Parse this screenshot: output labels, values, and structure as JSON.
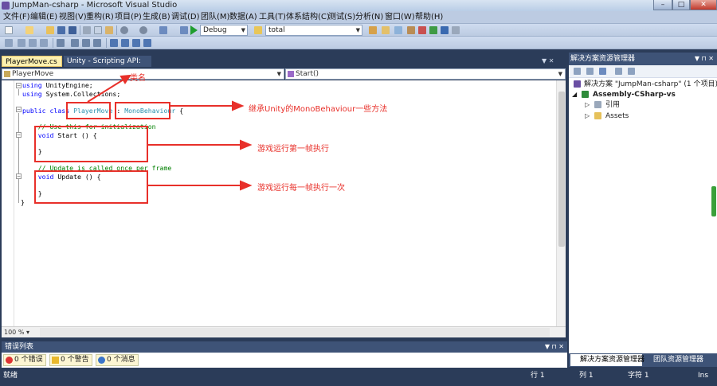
{
  "window": {
    "title": "JumpMan-csharp - Microsoft Visual Studio",
    "min": "–",
    "max": "□",
    "close": "✕"
  },
  "menu": [
    "文件(F)",
    "编辑(E)",
    "视图(V)",
    "重构(R)",
    "项目(P)",
    "生成(B)",
    "调试(D)",
    "团队(M)",
    "数据(A)",
    "工具(T)",
    "体系结构(C)",
    "测试(S)",
    "分析(N)",
    "窗口(W)",
    "帮助(H)"
  ],
  "toolbar": {
    "config": "Debug",
    "find": "total"
  },
  "tabs": [
    {
      "label": "PlayerMove.cs",
      "close": "×"
    },
    {
      "label": "Unity - Scripting API:"
    }
  ],
  "nav": {
    "left": "PlayerMove",
    "right": "Start()"
  },
  "code": {
    "lines": [
      {
        "t": "using UnityEngine;"
      },
      {
        "t": "using System.Collections;"
      },
      {
        "t": ""
      },
      {
        "t": "public class PlayerMove : MonoBehaviour {"
      },
      {
        "t": ""
      },
      {
        "t": "    // Use this for initialization"
      },
      {
        "t": "    void Start () {"
      },
      {
        "t": ""
      },
      {
        "t": "    }"
      },
      {
        "t": ""
      },
      {
        "t": "    // Update is called once per frame"
      },
      {
        "t": "    void Update () {"
      },
      {
        "t": ""
      },
      {
        "t": "    }"
      },
      {
        "t": "}"
      }
    ]
  },
  "zoom": "100 %",
  "annotations": {
    "class_name": "类名",
    "inherit": "继承Unity的MonoBehaviour一些方法",
    "start": "游戏运行第一帧执行",
    "update": "游戏运行每一帧执行一次"
  },
  "solution_explorer": {
    "title": "解决方案资源管理器",
    "solution": "解决方案 \"JumpMan-csharp\" (1 个项目)",
    "project": "Assembly-CSharp-vs",
    "items": [
      "引用",
      "Assets"
    ],
    "tab_solution": "解决方案资源管理器",
    "tab_team": "团队资源管理器"
  },
  "error_list": {
    "title": "错误列表",
    "errors": "0 个错误",
    "warnings": "0 个警告",
    "messages": "0 个消息"
  },
  "status": {
    "ready": "就绪",
    "row": "行 1",
    "col": "列 1",
    "char": "字符 1",
    "ins": "Ins"
  },
  "colors": {
    "accent": "#e8302a",
    "chrome": "#2b3c59",
    "active_tab": "#fcf0b0"
  }
}
